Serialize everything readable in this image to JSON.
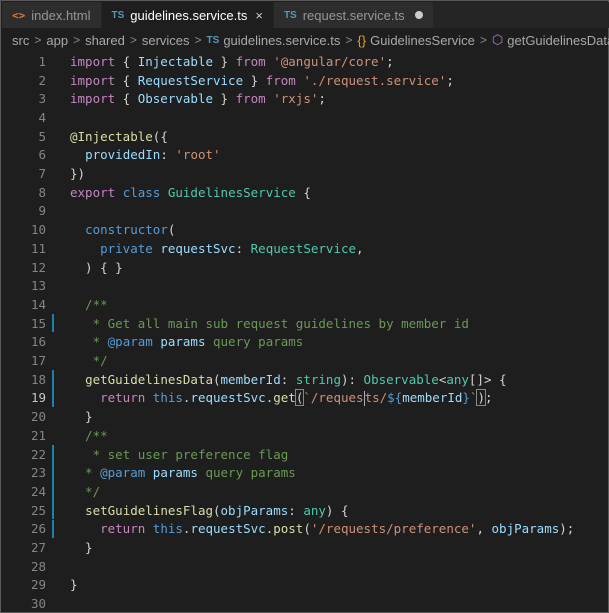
{
  "tabs": [
    {
      "icon": "<>",
      "label": "index.html",
      "active": false
    },
    {
      "icon": "TS",
      "label": "guidelines.service.ts",
      "active": true,
      "close": "×"
    },
    {
      "icon": "TS",
      "label": "request.service.ts",
      "active": false,
      "modified": true
    }
  ],
  "breadcrumb": {
    "src": "src",
    "app": "app",
    "shared": "shared",
    "services": "services",
    "file_icon": "TS",
    "file": "guidelines.service.ts",
    "class": "GuidelinesService",
    "method": "getGuidelinesData",
    "sep": ">"
  },
  "editor": {
    "line_numbers": [
      "1",
      "2",
      "3",
      "4",
      "5",
      "6",
      "7",
      "8",
      "9",
      "10",
      "11",
      "12",
      "13",
      "14",
      "15",
      "16",
      "17",
      "18",
      "19",
      "20",
      "21",
      "22",
      "23",
      "24",
      "25",
      "26",
      "27",
      "28",
      "29",
      "30"
    ],
    "tokens": {
      "import": "import",
      "from": "from",
      "export": "export",
      "class": "class",
      "private": "private",
      "return": "return",
      "this": "this",
      "any": "any",
      "string": "string",
      "Injectable": "Injectable",
      "RequestService": "RequestService",
      "Observable": "Observable",
      "GuidelinesService": "GuidelinesService",
      "angular_core": "'@angular/core'",
      "request_service": "'./request.service'",
      "rxjs": "'rxjs'",
      "root": "'root'",
      "providedIn": "providedIn",
      "constructor": "constructor",
      "requestSvc": "requestSvc",
      "dec": "@Injectable",
      "c15": " * Get all main sub request guidelines by member id",
      "c16_param": "@param",
      "c16_name": "params",
      "c16_desc": " query params",
      "c22": " * set user preference flag",
      "getGuidelinesData": "getGuidelinesData",
      "memberId": "memberId",
      "get": "get",
      "requests_a": "`/reques",
      "requests_b": "ts/",
      "tpl_open": "${",
      "tpl_close": "}",
      "tick": "`",
      "setGuidelinesFlag": "setGuidelinesFlag",
      "objParams": "objParams",
      "post": "post",
      "pref": "'/requests/preference'"
    }
  }
}
